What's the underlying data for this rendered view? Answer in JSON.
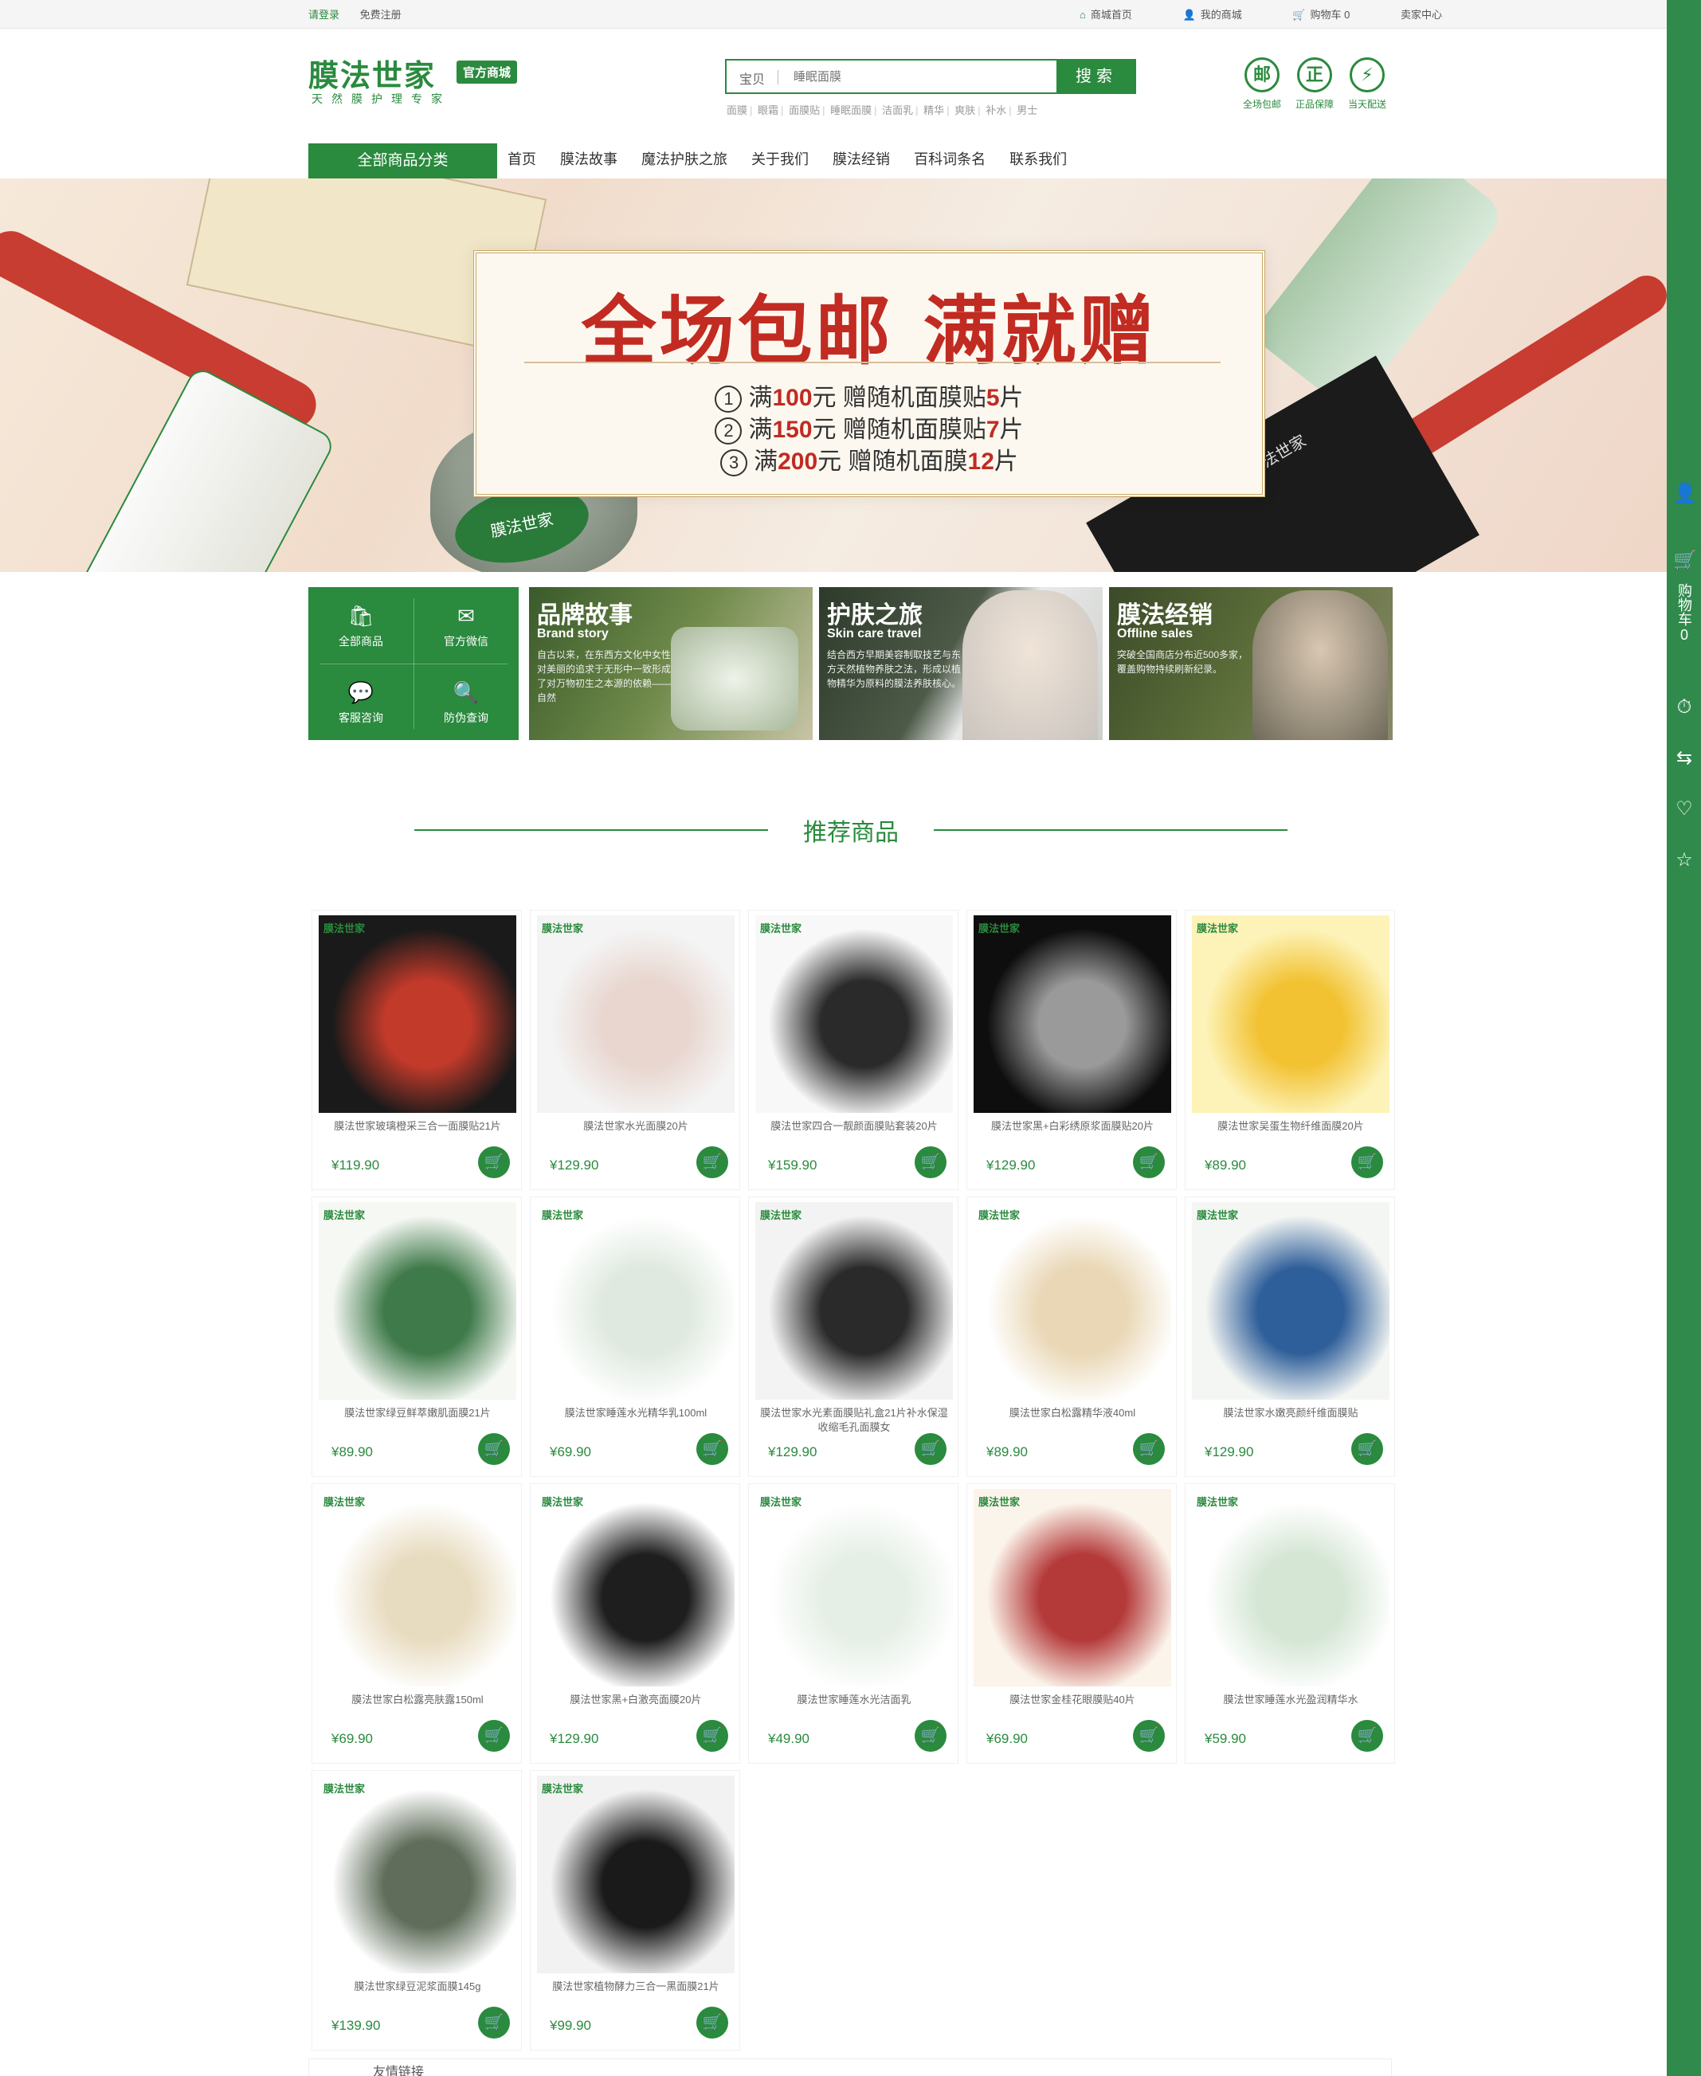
{
  "topbar": {
    "login": "请登录",
    "register": "免费注册",
    "home": "商城首页",
    "my_mall": "我的商城",
    "cart": "购物车 0",
    "seller": "卖家中心"
  },
  "logo": {
    "name": "膜法世家",
    "badge": "官方商城",
    "slogan": "天然膜护理专家"
  },
  "search": {
    "category": "宝贝",
    "placeholder": "睡眠面膜",
    "button": "搜索",
    "hot": [
      "面膜",
      "眼霜",
      "面膜贴",
      "睡眠面膜",
      "洁面乳",
      "精华",
      "爽肤",
      "补水",
      "男士"
    ]
  },
  "guarantees": [
    {
      "icon": "邮",
      "label": "全场包邮"
    },
    {
      "icon": "正",
      "label": "正品保障"
    },
    {
      "icon": "⚡",
      "label": "当天配送"
    }
  ],
  "nav": {
    "all": "全部商品分类",
    "items": [
      "首页",
      "膜法故事",
      "魔法护肤之旅",
      "关于我们",
      "膜法经销",
      "百科词条名",
      "联系我们"
    ]
  },
  "banner": {
    "headline": "全场包邮 满就赠",
    "offers": [
      {
        "num": "1",
        "pre": "满",
        "amount": "100",
        "unit": "元 赠随机面膜贴",
        "count": "5",
        "suffix": "片"
      },
      {
        "num": "2",
        "pre": "满",
        "amount": "150",
        "unit": "元 赠随机面膜贴",
        "count": "7",
        "suffix": "片"
      },
      {
        "num": "3",
        "pre": "满",
        "amount": "200",
        "unit": "元 赠随机面膜",
        "count": "12",
        "suffix": "片"
      }
    ],
    "jar_label": "膜法世家",
    "mask_label": "膜法世家"
  },
  "quick": [
    {
      "icon": "🛍",
      "label": "全部商品"
    },
    {
      "icon": "✉",
      "label": "官方微信"
    },
    {
      "icon": "💬",
      "label": "客服咨询"
    },
    {
      "icon": "🔍",
      "label": "防伪查询"
    }
  ],
  "promos": {
    "brand": {
      "title": "品牌故事",
      "subtitle": "Brand story",
      "desc": "自古以来，在东西方文化中女性对美丽的追求于无形中一致形成了对万物初生之本源的依赖——自然"
    },
    "skin": {
      "title": "护肤之旅",
      "subtitle": "Skin care travel",
      "desc": "结合西方早期美容制取技艺与东方天然植物养肤之法，形成以植物精华为原料的膜法养肤核心。"
    },
    "offline": {
      "title": "膜法经销",
      "subtitle": "Offline sales",
      "desc": "突破全国商店分布近500多家，覆盖购物持续刷新纪录。"
    }
  },
  "recommend": {
    "title": "推荐商品"
  },
  "products": [
    {
      "name": "膜法世家玻璃橙采三合一面膜贴21片",
      "price": "¥119.90"
    },
    {
      "name": "膜法世家水光面膜20片",
      "price": "¥129.90"
    },
    {
      "name": "膜法世家四合一靓颜面膜贴套装20片",
      "price": "¥159.90"
    },
    {
      "name": "膜法世家黑+白彩绣原浆面膜贴20片",
      "price": "¥129.90"
    },
    {
      "name": "膜法世家吴蛋生物纤维面膜20片",
      "price": "¥89.90"
    },
    {
      "name": "膜法世家绿豆鲜萃嫩肌面膜21片",
      "price": "¥89.90"
    },
    {
      "name": "膜法世家睡莲水光精华乳100ml",
      "price": "¥69.90"
    },
    {
      "name": "膜法世家水光素面膜贴礼盒21片补水保湿收缩毛孔面膜女",
      "price": "¥129.90"
    },
    {
      "name": "膜法世家白松露精华液40ml",
      "price": "¥89.90"
    },
    {
      "name": "膜法世家水嫩亮颜纤维面膜贴",
      "price": "¥129.90"
    },
    {
      "name": "膜法世家白松露亮肤露150ml",
      "price": "¥69.90"
    },
    {
      "name": "膜法世家黑+白激亮面膜20片",
      "price": "¥129.90"
    },
    {
      "name": "膜法世家睡莲水光洁面乳",
      "price": "¥49.90"
    },
    {
      "name": "膜法世家金桂花眼膜贴40片",
      "price": "¥69.90"
    },
    {
      "name": "膜法世家睡莲水光盈润精华水",
      "price": "¥59.90"
    },
    {
      "name": "膜法世家绿豆泥浆面膜145g",
      "price": "¥139.90"
    },
    {
      "name": "膜法世家植物酵力三合一黑面膜21片",
      "price": "¥99.90"
    }
  ],
  "product_brand": "膜法世家",
  "sidebar": {
    "cart_text": "购物车",
    "cart_count": "0"
  },
  "footer": {
    "links_title": "友情链接"
  }
}
